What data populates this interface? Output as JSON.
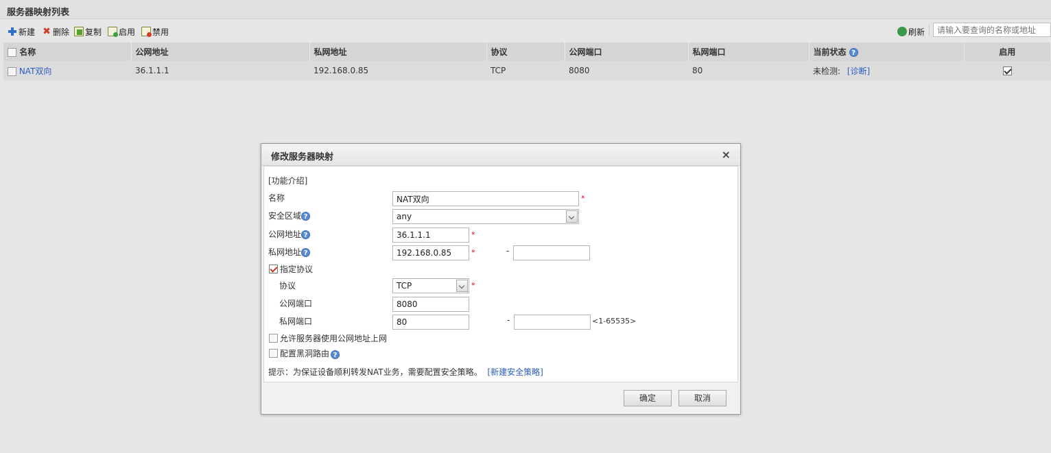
{
  "page": {
    "title": "服务器映射列表"
  },
  "toolbar": {
    "new_label": "新建",
    "delete_label": "删除",
    "copy_label": "复制",
    "enable_label": "启用",
    "disable_label": "禁用",
    "refresh_label": "刷新",
    "search_placeholder": "请输入要查询的名称或地址"
  },
  "table": {
    "headers": {
      "name": "名称",
      "public_address": "公网地址",
      "private_address": "私网地址",
      "protocol": "协议",
      "public_port": "公网端口",
      "private_port": "私网端口",
      "status": "当前状态",
      "enabled": "启用"
    },
    "rows": [
      {
        "name": "NAT双向",
        "public_address": "36.1.1.1",
        "private_address": "192.168.0.85",
        "protocol": "TCP",
        "public_port": "8080",
        "private_port": "80",
        "status": "未检测:",
        "diagnose": "[诊断]",
        "enabled": true
      }
    ]
  },
  "dialog": {
    "title": "修改服务器映射",
    "close": "×",
    "intro_link": "[功能介绍]",
    "labels": {
      "name": "名称",
      "security_zone": "安全区域",
      "public_address": "公网地址",
      "private_address": "私网地址",
      "specify_protocol": "指定协议",
      "protocol": "协议",
      "public_port": "公网端口",
      "private_port": "私网端口",
      "allow_public": "允许服务器使用公网地址上网",
      "blackhole": "配置黑洞路由"
    },
    "values": {
      "name": "NAT双向",
      "security_zone": "any",
      "public_address": "36.1.1.1",
      "private_address": "192.168.0.85",
      "private_address_end": "",
      "protocol": "TCP",
      "public_port": "8080",
      "private_port": "80",
      "private_port_end": ""
    },
    "required_mark": "*",
    "range_dash": "-",
    "port_range_hint": "<1-65535>",
    "help_glyph": "?",
    "tip_text": "提示：为保证设备顺利转发NAT业务，需要配置安全策略。",
    "tip_link": "[新建安全策略]",
    "ok_label": "确定",
    "cancel_label": "取消"
  },
  "colors": {
    "link": "#2a5bc4",
    "required": "#d0021b",
    "help_badge": "#5a8ad0"
  }
}
